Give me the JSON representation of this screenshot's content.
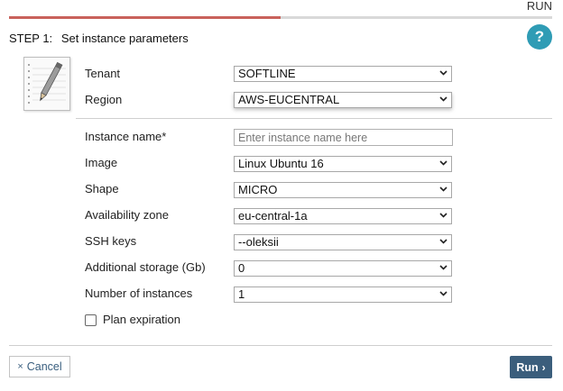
{
  "header": {
    "run_tab_label": "RUN",
    "progress_fraction": 0.5,
    "step_number": "STEP 1:",
    "step_title": "Set instance parameters",
    "help_label": "?"
  },
  "form": {
    "tenant": {
      "label": "Tenant",
      "value": "SOFTLINE"
    },
    "region": {
      "label": "Region",
      "value": "AWS-EUCENTRAL"
    },
    "instance_name": {
      "label": "Instance name*",
      "placeholder": "Enter instance name here",
      "value": ""
    },
    "image": {
      "label": "Image",
      "value": "Linux Ubuntu 16"
    },
    "shape": {
      "label": "Shape",
      "value": "MICRO"
    },
    "availability_zone": {
      "label": "Availability zone",
      "value": "eu-central-1a"
    },
    "ssh_keys": {
      "label": "SSH keys",
      "value": "--oleksii"
    },
    "additional_storage": {
      "label": "Additional storage (Gb)",
      "value": "0"
    },
    "number_of_instances": {
      "label": "Number of instances",
      "value": "1"
    },
    "plan_expiration": {
      "label": "Plan expiration",
      "checked": false
    }
  },
  "footer": {
    "cancel_icon": "×",
    "cancel_label": "Cancel",
    "run_label": "Run",
    "run_icon": "›"
  },
  "colors": {
    "progress_active": "#c9625b",
    "progress_track": "#d9d9d9",
    "help_button": "#2f9cb5",
    "run_button": "#3b5e7c",
    "cancel_text": "#3a5f7f"
  },
  "icons": {
    "step_icon": "notepad-pencil-icon",
    "help": "question-mark-icon",
    "select_indicator": "chevron-down-icon"
  }
}
